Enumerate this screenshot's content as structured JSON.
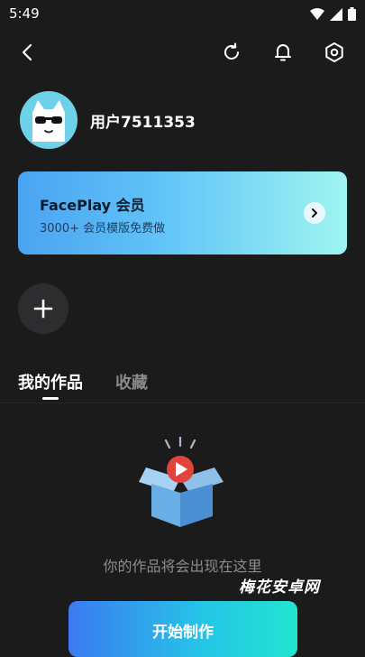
{
  "status_bar": {
    "time": "5:49"
  },
  "profile": {
    "username": "用户7511353"
  },
  "vip_card": {
    "title": "FacePlay 会员",
    "subtitle": "3000+ 会员模版免费做"
  },
  "tabs": [
    {
      "label": "我的作品",
      "active": true
    },
    {
      "label": "收藏",
      "active": false
    }
  ],
  "empty_state": {
    "message": "你的作品将会出现在这里"
  },
  "primary_action": {
    "label": "开始制作"
  },
  "watermark": {
    "text": "梅花安卓网"
  },
  "colors": {
    "background": "#1b1b1c",
    "vip_gradient_start": "#4aa3f2",
    "vip_gradient_end": "#9ff5f0",
    "button_gradient_start": "#3b7bf2",
    "button_gradient_end": "#21e5cf"
  },
  "icons": [
    "back-arrow-icon",
    "refresh-icon",
    "bell-icon",
    "settings-icon",
    "chevron-right-icon",
    "plus-icon",
    "wifi-icon",
    "signal-icon",
    "battery-icon"
  ]
}
